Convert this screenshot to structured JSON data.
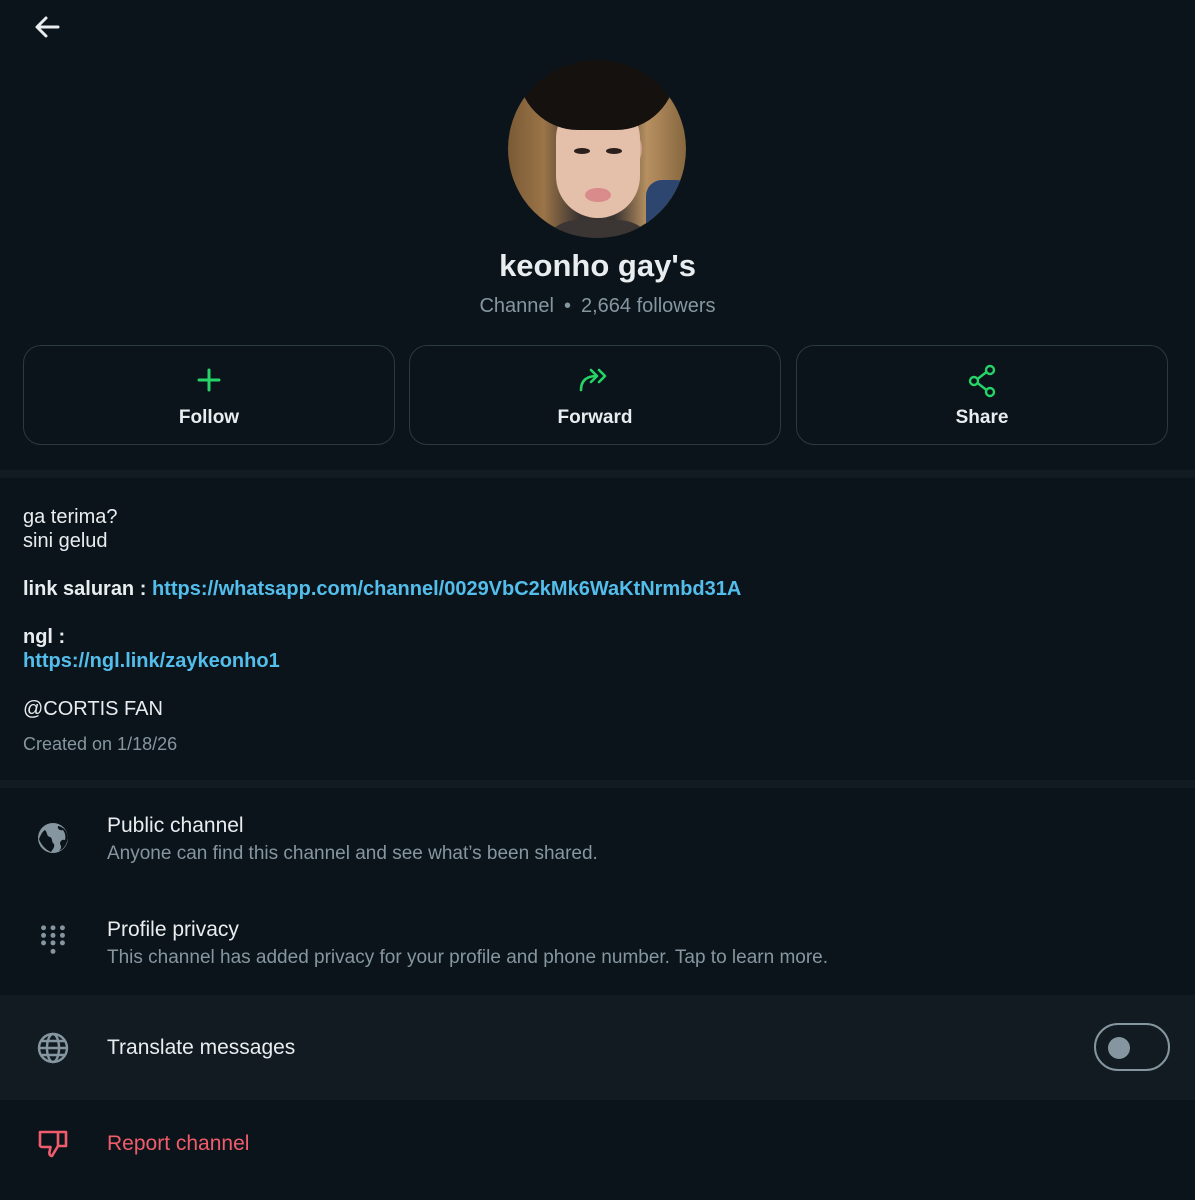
{
  "header": {
    "back_icon": "arrow-left-icon"
  },
  "channel": {
    "name": "keonho gay's",
    "type": "Channel",
    "separator": "•",
    "followers": "2,664 followers"
  },
  "actions": [
    {
      "label": "Follow",
      "icon": "plus-icon"
    },
    {
      "label": "Forward",
      "icon": "forward-icon"
    },
    {
      "label": "Share",
      "icon": "share-icon"
    }
  ],
  "about": {
    "line1": "ga terima?",
    "line2": "sini gelud",
    "link_label": "link saluran :",
    "link_url": "https://whatsapp.com/channel/0029VbC2kMk6WaKtNrmbd31A",
    "ngl_label": "ngl :",
    "ngl_url": "https://ngl.link/zaykeonho1",
    "mention": "@CORTIS FAN",
    "created": "Created on 1/18/26"
  },
  "settings": {
    "public": {
      "title": "Public channel",
      "subtitle": "Anyone can find this channel and see what’s been shared.",
      "icon": "globe-filled-icon"
    },
    "privacy": {
      "title": "Profile privacy",
      "subtitle": "This channel has added privacy for your profile and phone number. Tap to learn more.",
      "icon": "dialpad-icon"
    },
    "translate": {
      "title": "Translate messages",
      "icon": "globe-outline-icon",
      "toggle_on": false
    },
    "report": {
      "title": "Report channel",
      "icon": "thumbs-down-icon"
    }
  },
  "colors": {
    "accent_green": "#25d366",
    "link_blue": "#53bdeb",
    "danger_red": "#f15c6d",
    "background": "#0b141a"
  }
}
